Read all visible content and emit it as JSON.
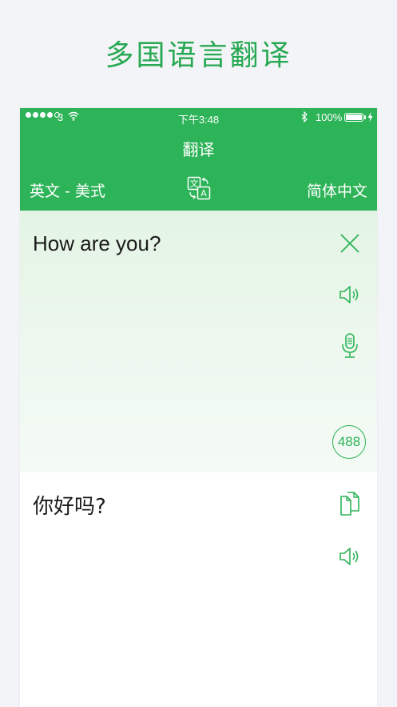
{
  "promo": {
    "title": "多国语言翻译"
  },
  "status_bar": {
    "carrier": "3",
    "time": "下午3:48",
    "battery": "100%",
    "icons": [
      "wifi-icon",
      "bluetooth-icon",
      "battery-icon",
      "charging-icon"
    ]
  },
  "header": {
    "title": "翻译",
    "source_language": "英文 - 美式",
    "target_language": "简体中文",
    "swap_icon": "translate-swap-icon"
  },
  "input": {
    "text": "How are you?",
    "char_count": "488",
    "icons": [
      "close-icon",
      "speaker-icon",
      "microphone-icon"
    ]
  },
  "output": {
    "text": "你好吗?",
    "icons": [
      "copy-icon",
      "speaker-icon"
    ]
  },
  "colors": {
    "brand_green": "#2db358",
    "title_green": "#27a852",
    "input_bg": "#e8f6e9",
    "page_bg": "#f3f4f7"
  }
}
